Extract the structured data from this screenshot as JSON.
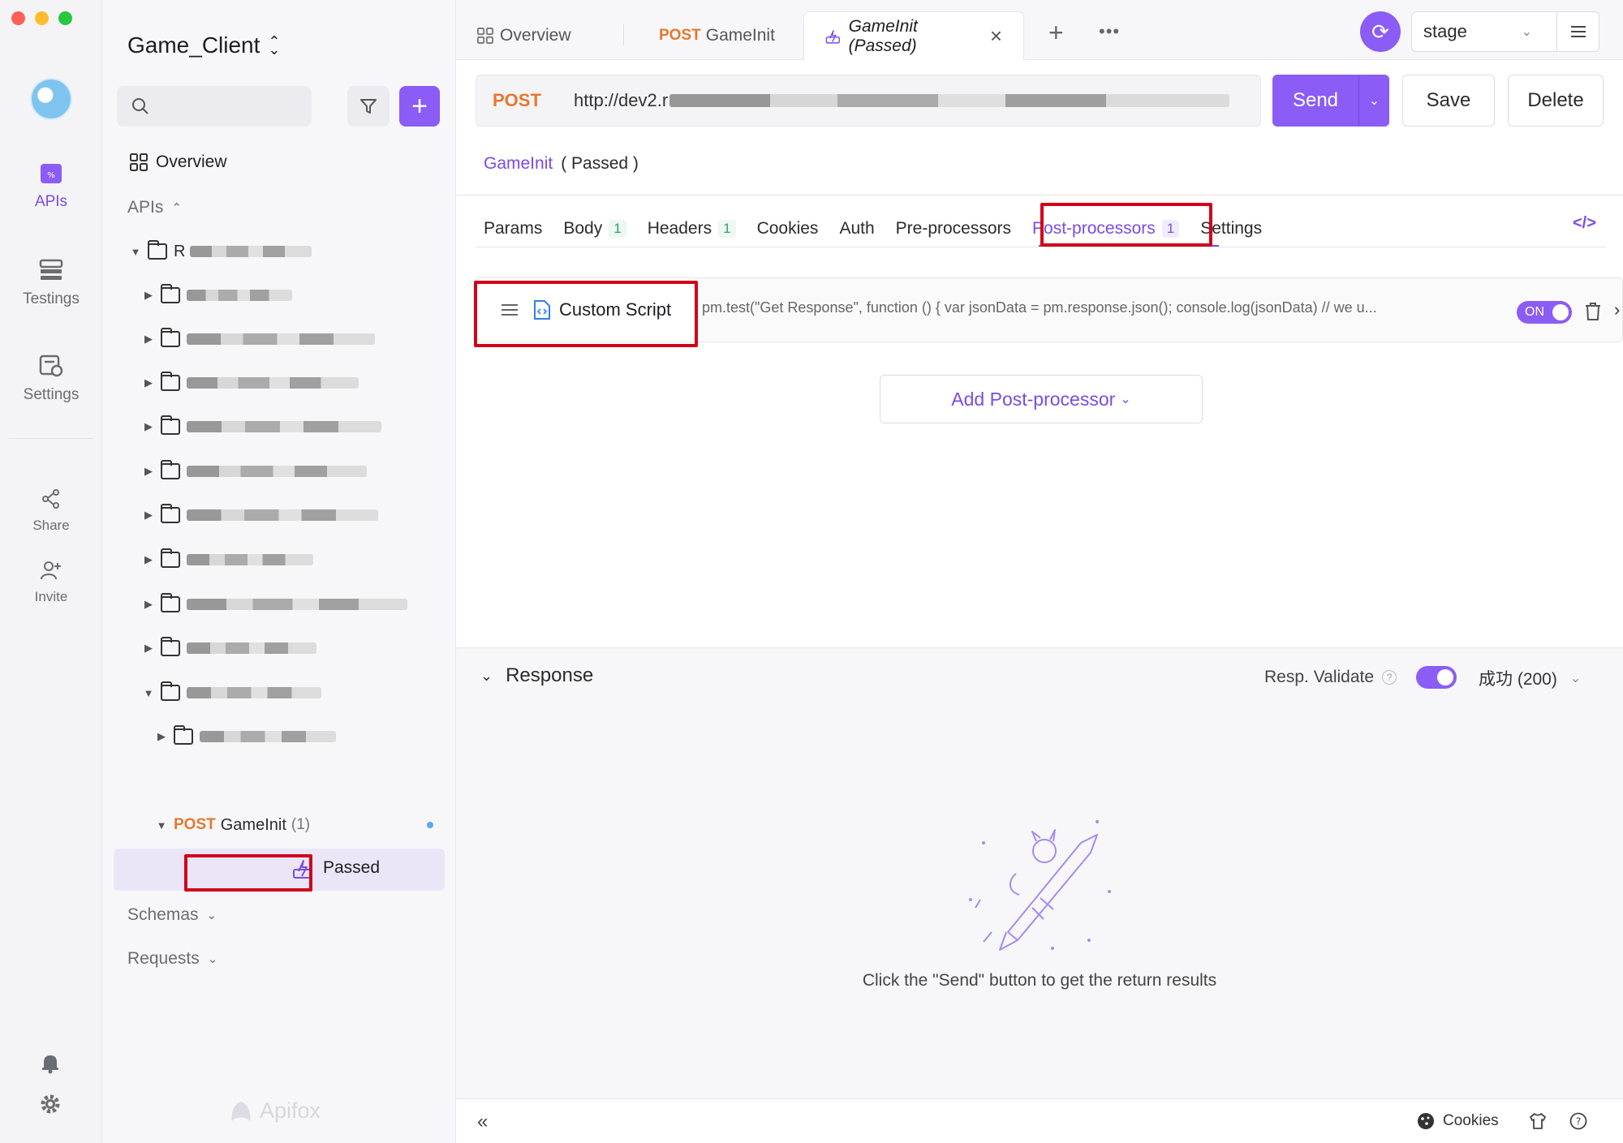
{
  "rail": {
    "items": [
      {
        "label": "APIs",
        "icon": "apis-icon",
        "active": true
      },
      {
        "label": "Testings",
        "icon": "testings-icon"
      },
      {
        "label": "Settings",
        "icon": "settings-icon"
      },
      {
        "label": "Share",
        "icon": "share-icon"
      },
      {
        "label": "Invite",
        "icon": "invite-icon"
      }
    ]
  },
  "sidebar": {
    "project_name": "Game_Client",
    "search_placeholder": "",
    "overview_label": "Overview",
    "apis_label": "APIs",
    "root_folder_prefix": "R",
    "api": {
      "method": "POST",
      "name": "GameInit",
      "count": "(1)"
    },
    "case": {
      "label": "Passed"
    },
    "schemas_label": "Schemas",
    "requests_label": "Requests",
    "brand": "Apifox"
  },
  "tabs": [
    {
      "label": "Overview",
      "icon": "grid-icon"
    },
    {
      "method": "POST",
      "label": "GameInit"
    },
    {
      "label": "GameInit (Passed)",
      "icon": "case-icon",
      "active": true
    }
  ],
  "env": {
    "selected": "stage"
  },
  "request": {
    "method": "POST",
    "url_prefix": "http://dev2.r",
    "send_label": "Send",
    "save_label": "Save",
    "delete_label": "Delete"
  },
  "breadcrumb": {
    "link": "GameInit",
    "suffix": "( Passed )"
  },
  "subtabs": [
    {
      "label": "Params"
    },
    {
      "label": "Body",
      "badge": "1"
    },
    {
      "label": "Headers",
      "badge": "1"
    },
    {
      "label": "Cookies"
    },
    {
      "label": "Auth"
    },
    {
      "label": "Pre-processors"
    },
    {
      "label": "Post-processors",
      "badge": "1",
      "active": true
    },
    {
      "label": "Settings"
    }
  ],
  "processor": {
    "name": "Custom Script",
    "code_preview": "pm.test(\"Get Response\", function () { var jsonData = pm.response.json(); console.log(jsonData) // we u...",
    "toggle_label": "ON"
  },
  "add_processor_label": "Add Post-processor",
  "response": {
    "title": "Response",
    "validate_label": "Resp. Validate",
    "status_label": "成功 (200)",
    "empty_hint": "Click the \"Send\" button to get the return results"
  },
  "footer": {
    "cookies_label": "Cookies"
  },
  "colors": {
    "accent": "#8b5cf6",
    "post": "#e8772e",
    "highlight": "#d0021b"
  }
}
